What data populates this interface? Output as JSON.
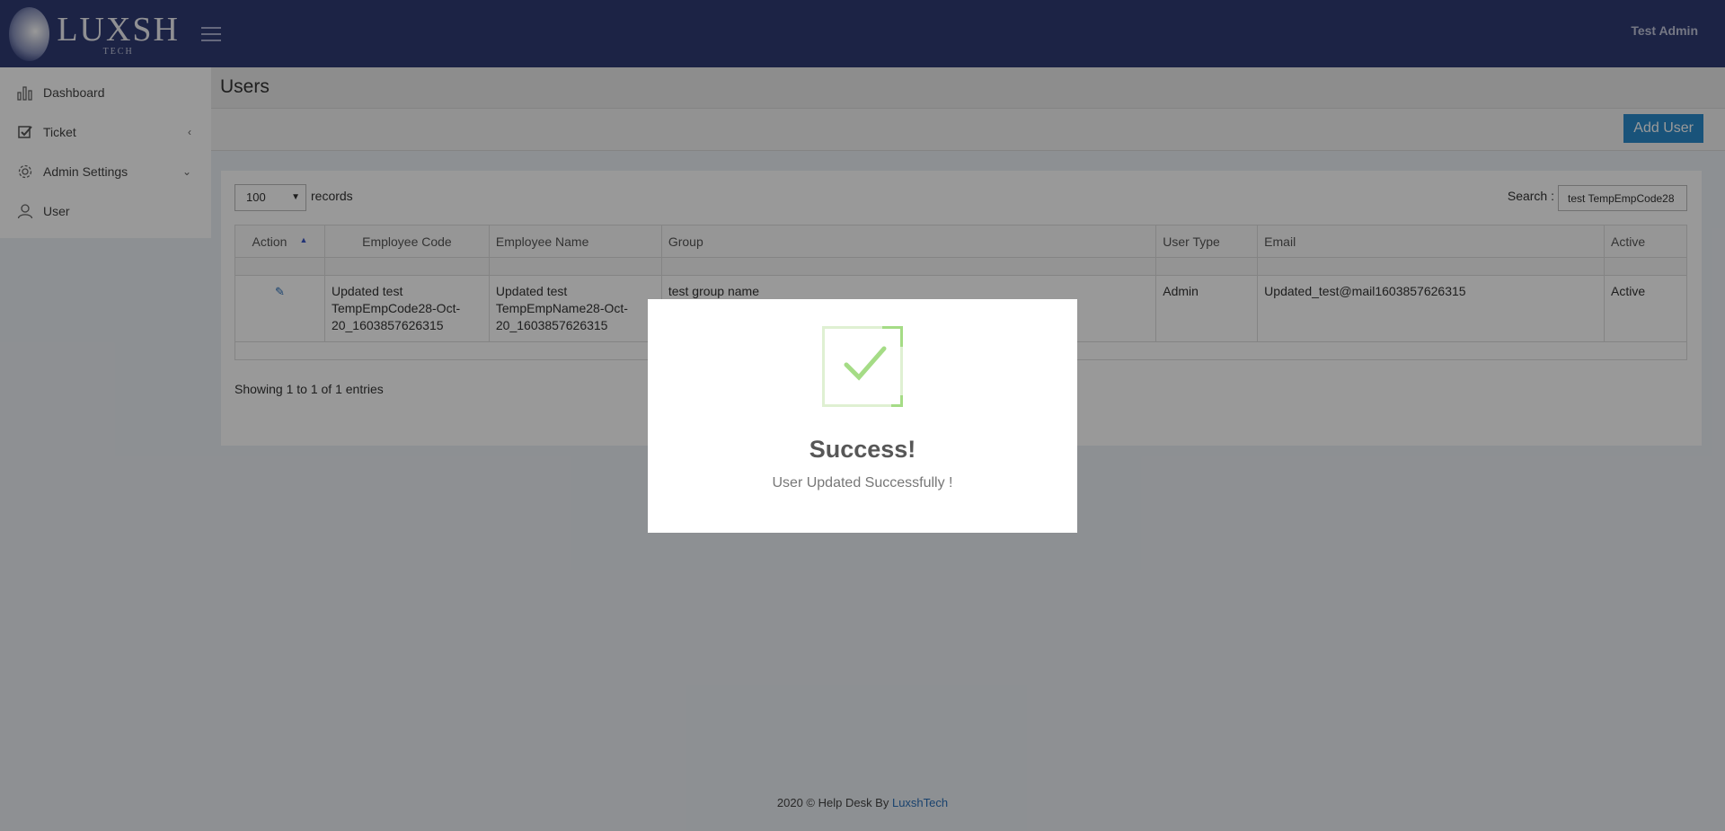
{
  "header": {
    "logo_text": "LUXSH",
    "logo_sub": "TECH",
    "user_name": "Test Admin"
  },
  "sidebar": {
    "items": [
      {
        "label": "Dashboard",
        "icon": "bar-chart-icon"
      },
      {
        "label": "Ticket",
        "icon": "checkbox-icon",
        "chevron": "‹"
      },
      {
        "label": "Admin Settings",
        "icon": "gear-icon",
        "chevron": "⌄"
      },
      {
        "label": "User",
        "icon": "user-icon"
      }
    ]
  },
  "page": {
    "title": "Users",
    "add_button": "Add User"
  },
  "table_controls": {
    "page_length": "100",
    "records_label": "records",
    "search_label": "Search :",
    "search_value": "test TempEmpCode28"
  },
  "table": {
    "columns": [
      "Action",
      "Employee Code",
      "Employee Name",
      "Group",
      "User Type",
      "Email",
      "Active"
    ],
    "rows": [
      {
        "employee_code": "Updated test TempEmpCode28-Oct-20_1603857626315",
        "employee_name": "Updated test TempEmpName28-Oct-20_1603857626315",
        "group": "test group name",
        "user_type": "Admin",
        "email": "Updated_test@mail1603857626315",
        "active": "Active"
      }
    ],
    "info": "Showing 1 to 1 of 1 entries"
  },
  "footer": {
    "text": "2020 © Help Desk By ",
    "link": "LuxshTech"
  },
  "modal": {
    "title": "Success!",
    "message": "User Updated Successfully !"
  },
  "colors": {
    "topbar": "#2f3b73",
    "accent": "#2a8bcc",
    "success": "#a5dc86"
  }
}
